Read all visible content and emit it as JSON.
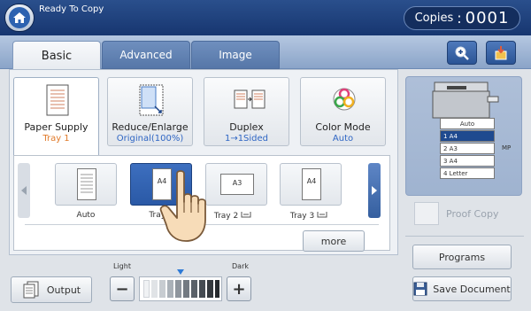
{
  "header": {
    "status": "Ready To Copy",
    "copies_label": "Copies",
    "copies_value": "0001"
  },
  "tabs": [
    {
      "label": "Basic"
    },
    {
      "label": "Advanced"
    },
    {
      "label": "Image"
    }
  ],
  "functions": [
    {
      "label": "Paper Supply",
      "value": "Tray 1"
    },
    {
      "label": "Reduce/Enlarge",
      "value": "Original(100%)"
    },
    {
      "label": "Duplex",
      "value": "1→1Sided"
    },
    {
      "label": "Color Mode",
      "value": "Auto"
    }
  ],
  "trays": [
    {
      "label": "Auto",
      "paper": ""
    },
    {
      "label": "Tray 1",
      "paper": "A4"
    },
    {
      "label": "Tray 2",
      "paper": "A3"
    },
    {
      "label": "Tray 3",
      "paper": "A4"
    }
  ],
  "more_label": "more",
  "bottom": {
    "output_label": "Output",
    "light_label": "Light",
    "dark_label": "Dark"
  },
  "machine": {
    "rows": [
      {
        "text": "Auto"
      },
      {
        "text": "1  A4"
      },
      {
        "text": "2  A3"
      },
      {
        "text": "3  A4"
      },
      {
        "text": "4  Letter"
      }
    ],
    "mp_label": "MP"
  },
  "right": {
    "proof_label": "Proof Copy",
    "programs_label": "Programs",
    "save_label": "Save Document"
  },
  "colors": {
    "accent": "#2f66c4",
    "selected_value": "#e07a2a"
  }
}
